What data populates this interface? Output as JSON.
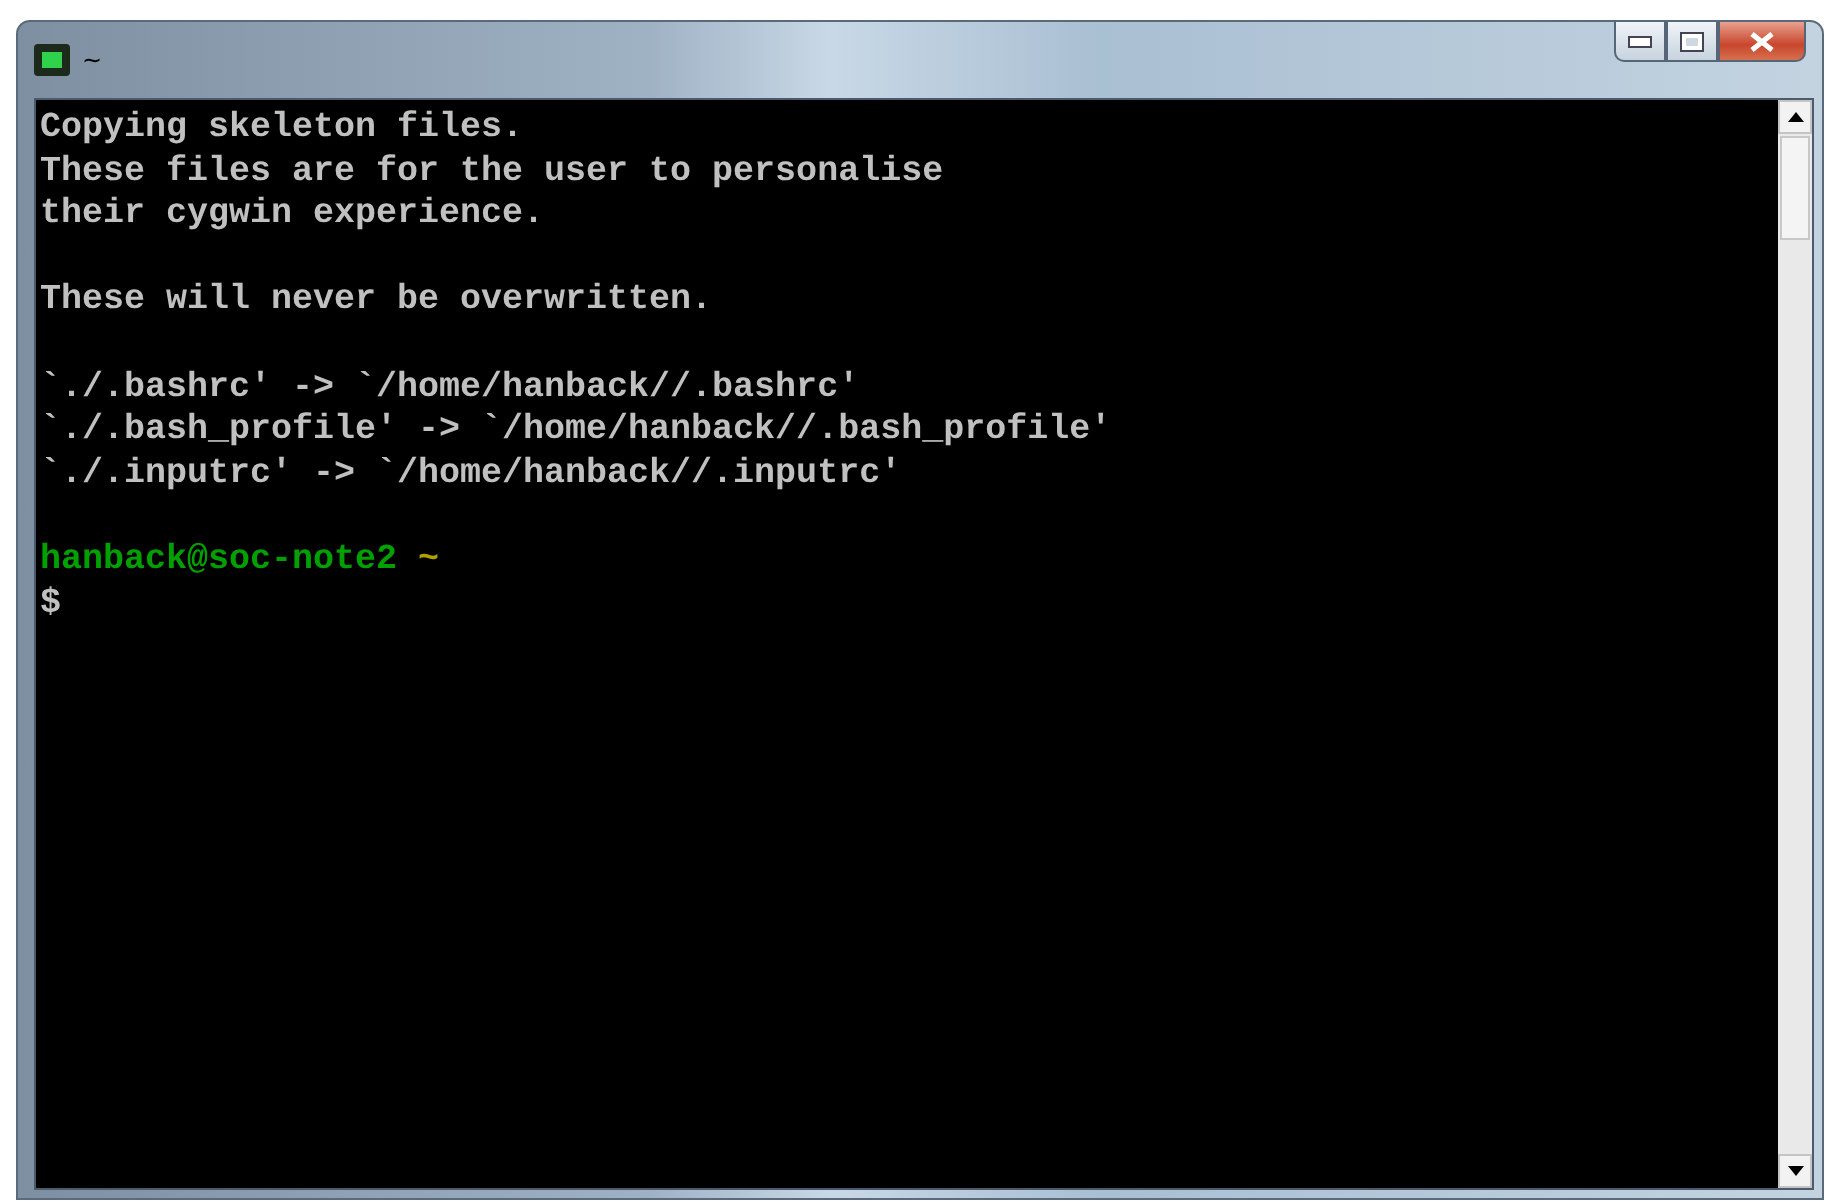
{
  "window": {
    "title": "~"
  },
  "terminal": {
    "lines": [
      {
        "kind": "output",
        "text": "Copying skeleton files."
      },
      {
        "kind": "output",
        "text": "These files are for the user to personalise"
      },
      {
        "kind": "output",
        "text": "their cygwin experience."
      },
      {
        "kind": "blank"
      },
      {
        "kind": "output",
        "text": "These will never be overwritten."
      },
      {
        "kind": "blank"
      },
      {
        "kind": "output",
        "text": "`./.bashrc' -> `/home/hanback//.bashrc'"
      },
      {
        "kind": "output",
        "text": "`./.bash_profile' -> `/home/hanback//.bash_profile'"
      },
      {
        "kind": "output",
        "text": "`./.inputrc' -> `/home/hanback//.inputrc'"
      },
      {
        "kind": "blank"
      },
      {
        "kind": "prompt",
        "user_host": "hanback@soc-note2",
        "path": "~"
      },
      {
        "kind": "input",
        "text": "$"
      }
    ]
  }
}
